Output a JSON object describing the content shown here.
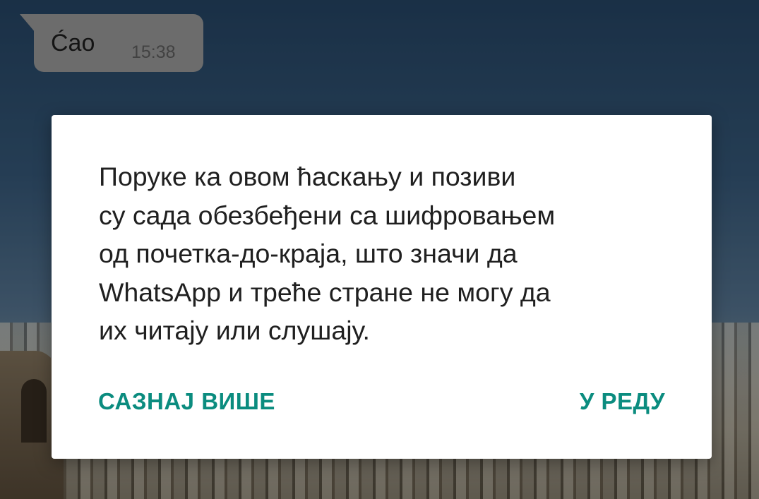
{
  "chat": {
    "message": {
      "text": "Ćao",
      "time": "15:38"
    }
  },
  "dialog": {
    "message": "Поруке ка овом ћаскању и позиви\nсу сада обезбеђени са шифровањем\nод почетка-до-краја, што значи да\nWhatsApp и треће стране не могу да\nих читају или слушају.",
    "learn_more_label": "САЗНАЈ ВИШЕ",
    "ok_label": "У РЕДУ"
  },
  "colors": {
    "accent": "#0b8c7f",
    "bubble": "#a6a6a6",
    "dialog_background": "#ffffff"
  }
}
